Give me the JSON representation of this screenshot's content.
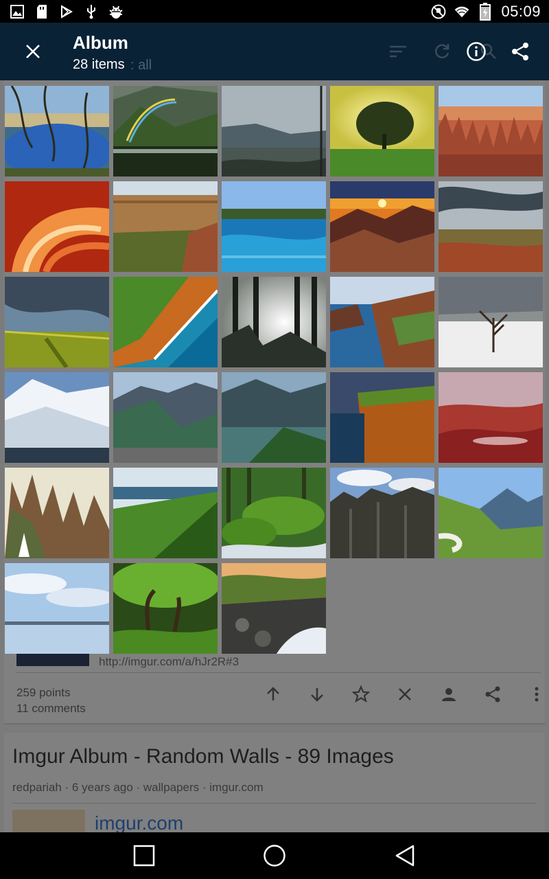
{
  "status_bar": {
    "time": "05:09",
    "left_icons": [
      "image-icon",
      "sd-card-icon",
      "play-store-icon",
      "usb-icon",
      "android-debug-icon"
    ],
    "right_icons": [
      "silent-mode-icon",
      "wifi-icon",
      "battery-charging-icon"
    ]
  },
  "app_bar": {
    "title": "Album",
    "subtitle": "28 items",
    "ghost_text": ": all",
    "bg_color": "#0a2236"
  },
  "album": {
    "images": [
      {
        "name": "reflection-lake"
      },
      {
        "name": "rainbow-valley"
      },
      {
        "name": "misty-bay"
      },
      {
        "name": "lone-tree-sunrise"
      },
      {
        "name": "red-hoodoos"
      },
      {
        "name": "antelope-canyon"
      },
      {
        "name": "canyon-cliffs"
      },
      {
        "name": "blue-lagoon"
      },
      {
        "name": "mountain-sunset"
      },
      {
        "name": "cloudy-plains"
      },
      {
        "name": "green-field-sky"
      },
      {
        "name": "coastal-cliffs-aerial"
      },
      {
        "name": "misty-forest"
      },
      {
        "name": "rocky-coastline"
      },
      {
        "name": "snowy-dead-tree"
      },
      {
        "name": "snow-mountain"
      },
      {
        "name": "fjord-mountains"
      },
      {
        "name": "milford-sound"
      },
      {
        "name": "sea-cliff-orange"
      },
      {
        "name": "red-dunes"
      },
      {
        "name": "jagged-ridges-sailboat"
      },
      {
        "name": "green-ridge-ocean"
      },
      {
        "name": "mossy-rocks-stream"
      },
      {
        "name": "rock-towers"
      },
      {
        "name": "alpine-valley"
      },
      {
        "name": "calm-lake-clouds"
      },
      {
        "name": "mossy-forest"
      },
      {
        "name": "rocky-river-sunset"
      }
    ]
  },
  "background_post": {
    "link": "http://imgur.com/a/hJr2R#3",
    "points": "259 points",
    "comments": "11 comments"
  },
  "background_post2": {
    "title": "Imgur Album - Random Walls - 89 Images",
    "meta": "redpariah · 6 years ago · wallpapers · imgur.com",
    "domain": "imgur.com"
  }
}
